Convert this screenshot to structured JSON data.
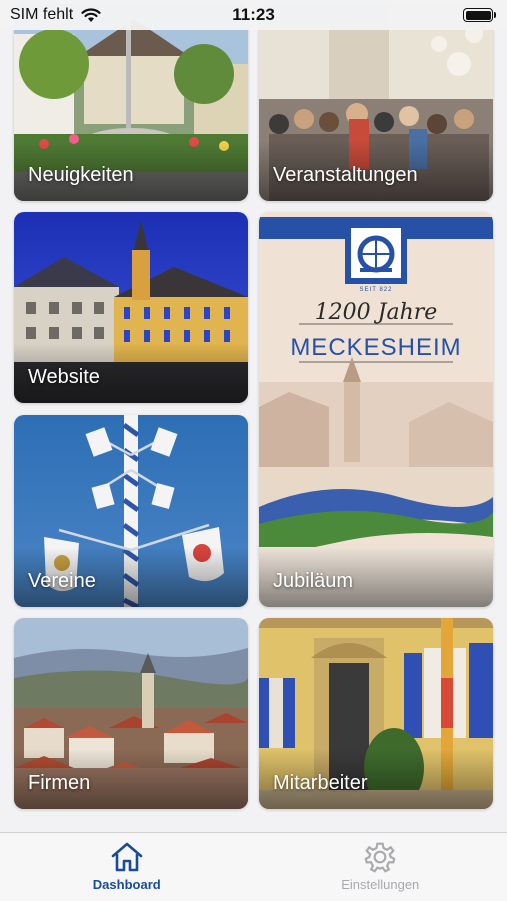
{
  "status_bar": {
    "carrier": "SIM fehlt",
    "time": "11:23"
  },
  "tiles": [
    {
      "label": "Neuigkeiten"
    },
    {
      "label": "Veranstaltungen"
    },
    {
      "label": "Website"
    },
    {
      "label": "Jubiläum"
    },
    {
      "label": "Vereine"
    },
    {
      "label": "Firmen"
    },
    {
      "label": "Mitarbeiter"
    }
  ],
  "jubilee_poster": {
    "seit": "SEIT 822",
    "years": "1200 Jahre",
    "town": "MECKESHEIM"
  },
  "tab_bar": {
    "items": [
      {
        "label": "Dashboard",
        "icon": "home-icon"
      },
      {
        "label": "Einstellungen",
        "icon": "gear-icon"
      }
    ]
  },
  "colors": {
    "accent": "#1a4b97",
    "inactive": "#a9a9ad",
    "background": "#f2f2f4"
  }
}
